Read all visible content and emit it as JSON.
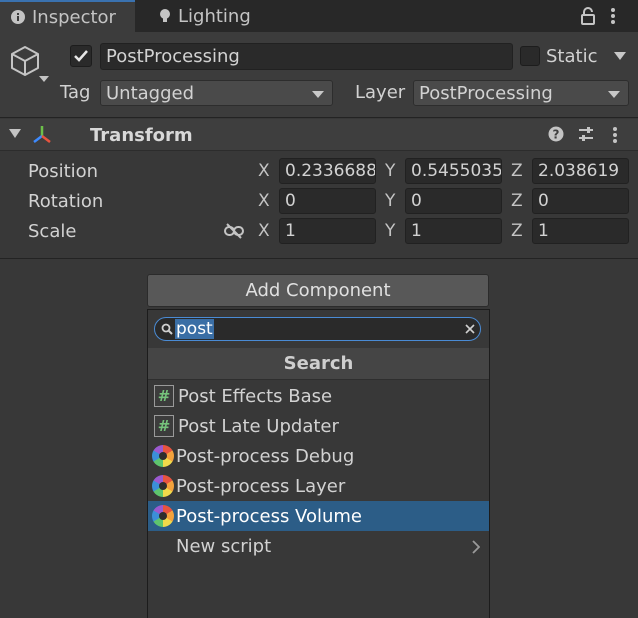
{
  "tabs": [
    {
      "label": "Inspector",
      "icon": "info-icon",
      "active": true
    },
    {
      "label": "Lighting",
      "icon": "lightbulb-icon",
      "active": false
    }
  ],
  "gameobject": {
    "active": true,
    "name": "PostProcessing",
    "static_label": "Static",
    "static_checked": false,
    "tag_label": "Tag",
    "tag_value": "Untagged",
    "layer_label": "Layer",
    "layer_value": "PostProcessing"
  },
  "transform": {
    "title": "Transform",
    "rows": [
      {
        "label": "Position",
        "x": "0.2336688",
        "y": "0.5455035",
        "z": "2.038619"
      },
      {
        "label": "Rotation",
        "x": "0",
        "y": "0",
        "z": "0"
      },
      {
        "label": "Scale",
        "x": "1",
        "y": "1",
        "z": "1"
      }
    ],
    "axis_labels": [
      "X",
      "Y",
      "Z"
    ]
  },
  "add_component": {
    "button_label": "Add Component",
    "search_value": "post",
    "section_title": "Search",
    "items": [
      {
        "label": "Post Effects Base",
        "icon": "script-hash-icon",
        "selected": false
      },
      {
        "label": "Post Late Updater",
        "icon": "script-hash-icon",
        "selected": false
      },
      {
        "label": "Post-process Debug",
        "icon": "post-process-icon",
        "selected": false
      },
      {
        "label": "Post-process Layer",
        "icon": "post-process-icon",
        "selected": false
      },
      {
        "label": "Post-process Volume",
        "icon": "post-process-icon",
        "selected": true
      },
      {
        "label": "New script",
        "icon": "chevron-right-icon",
        "selected": false
      }
    ]
  },
  "colors": {
    "selection": "#2c5d87",
    "accent": "#4a8bd4",
    "background": "#383838"
  }
}
